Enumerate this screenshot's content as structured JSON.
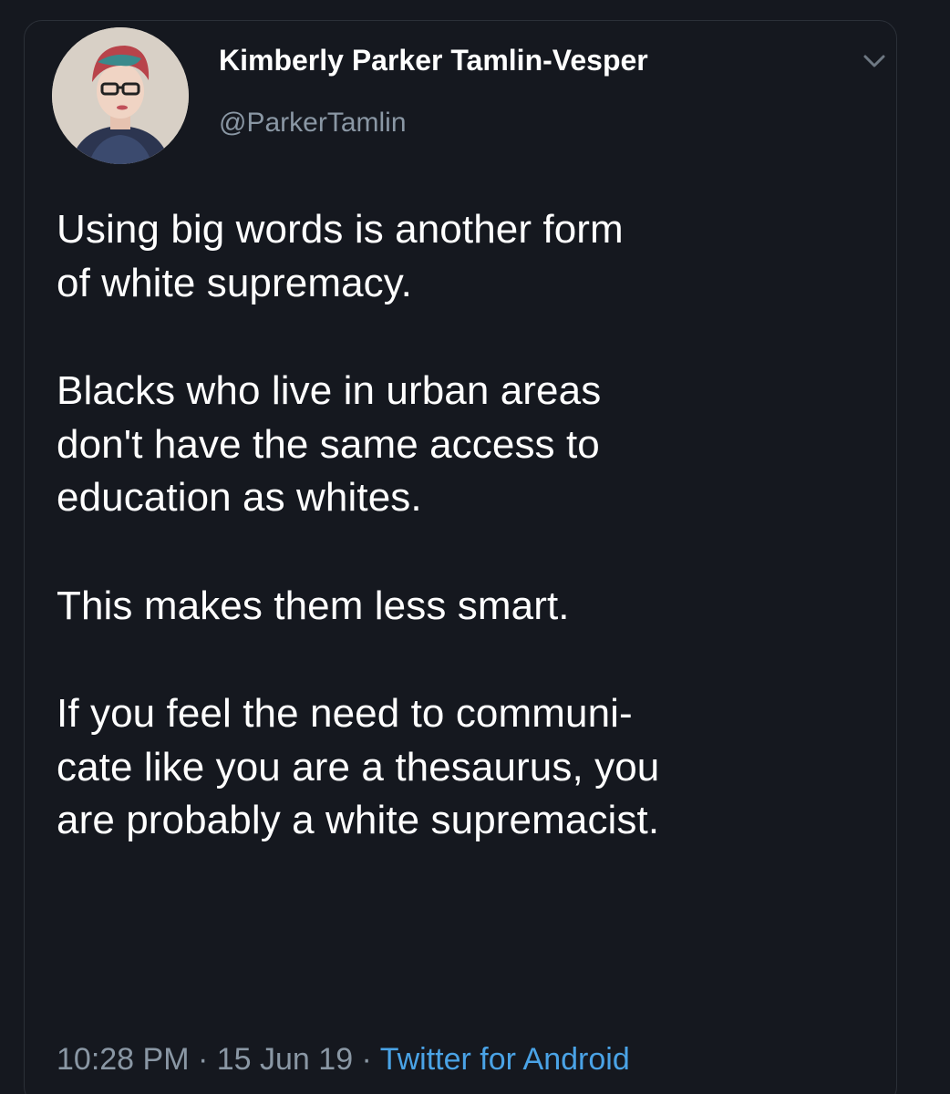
{
  "author": {
    "display_name": "Kimberly Parker Tamlin-Vesper",
    "handle": "@ParkerTamlin"
  },
  "tweet": {
    "paragraphs": [
      "Using big words is another form\nof white supremacy.",
      "Blacks who live in urban areas\ndon't have the same access to\neducation as whites.",
      "This makes them less smart.",
      "If you feel the need to communi-\ncate like you are a thesaurus, you\nare probably a white supremacist."
    ]
  },
  "meta": {
    "time": "10:28 PM",
    "separator": " · ",
    "date": "15 Jun 19",
    "source": "Twitter for Android"
  },
  "icons": {
    "menu": "chevron-down-icon"
  },
  "colors": {
    "background": "#15181f",
    "secondary_text": "#8a97a4",
    "link": "#4aa3e6"
  }
}
